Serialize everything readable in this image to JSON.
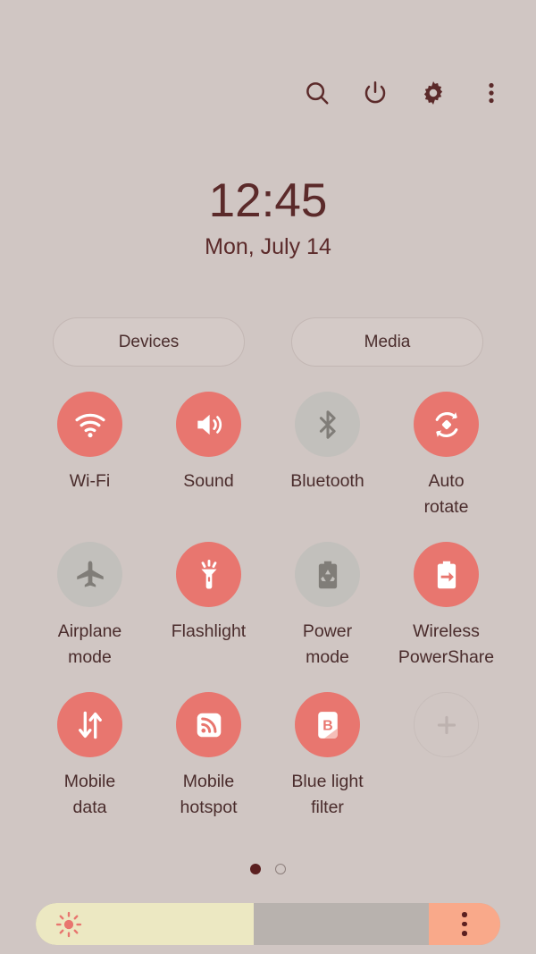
{
  "header": {
    "icons": [
      {
        "name": "search-icon",
        "label": "Search"
      },
      {
        "name": "power-icon",
        "label": "Power off"
      },
      {
        "name": "gear-icon",
        "label": "Settings"
      },
      {
        "name": "more-vertical-icon",
        "label": "More options"
      }
    ]
  },
  "clock": {
    "time": "12:45",
    "date": "Mon, July 14"
  },
  "shortcuts": {
    "devices_label": "Devices",
    "media_label": "Media"
  },
  "colors": {
    "background": "#d0c6c3",
    "active_toggle": "#e8766f",
    "inactive_toggle": "#c2c0bc",
    "text": "#4a2c2c",
    "header_icon": "#5b2a2a",
    "slider_fill": "#ece8c2",
    "slider_track": "#b8b2ae",
    "slider_menu": "#f9a98a"
  },
  "toggles": [
    {
      "label": "Wi-Fi",
      "icon": "wifi-icon",
      "state": "on"
    },
    {
      "label": "Sound",
      "icon": "sound-icon",
      "state": "on"
    },
    {
      "label": "Bluetooth",
      "icon": "bluetooth-icon",
      "state": "off"
    },
    {
      "label": "Auto\nrotate",
      "icon": "auto-rotate-icon",
      "state": "on"
    },
    {
      "label": "Airplane\nmode",
      "icon": "airplane-icon",
      "state": "off"
    },
    {
      "label": "Flashlight",
      "icon": "flashlight-icon",
      "state": "on"
    },
    {
      "label": "Power\nmode",
      "icon": "power-mode-icon",
      "state": "off"
    },
    {
      "label": "Wireless\nPowerShare",
      "icon": "powershare-icon",
      "state": "on"
    },
    {
      "label": "Mobile\ndata",
      "icon": "mobile-data-icon",
      "state": "on"
    },
    {
      "label": "Mobile\nhotspot",
      "icon": "hotspot-icon",
      "state": "on"
    },
    {
      "label": "Blue light\nfilter",
      "icon": "blue-light-icon",
      "state": "on"
    },
    {
      "label": "",
      "icon": "add-icon",
      "state": "add"
    }
  ],
  "pagination": {
    "current_page": 1,
    "total_pages": 2
  },
  "brightness": {
    "value_percent": 47,
    "sun_icon": "brightness-sun-icon",
    "menu_icon": "more-vertical-icon"
  }
}
